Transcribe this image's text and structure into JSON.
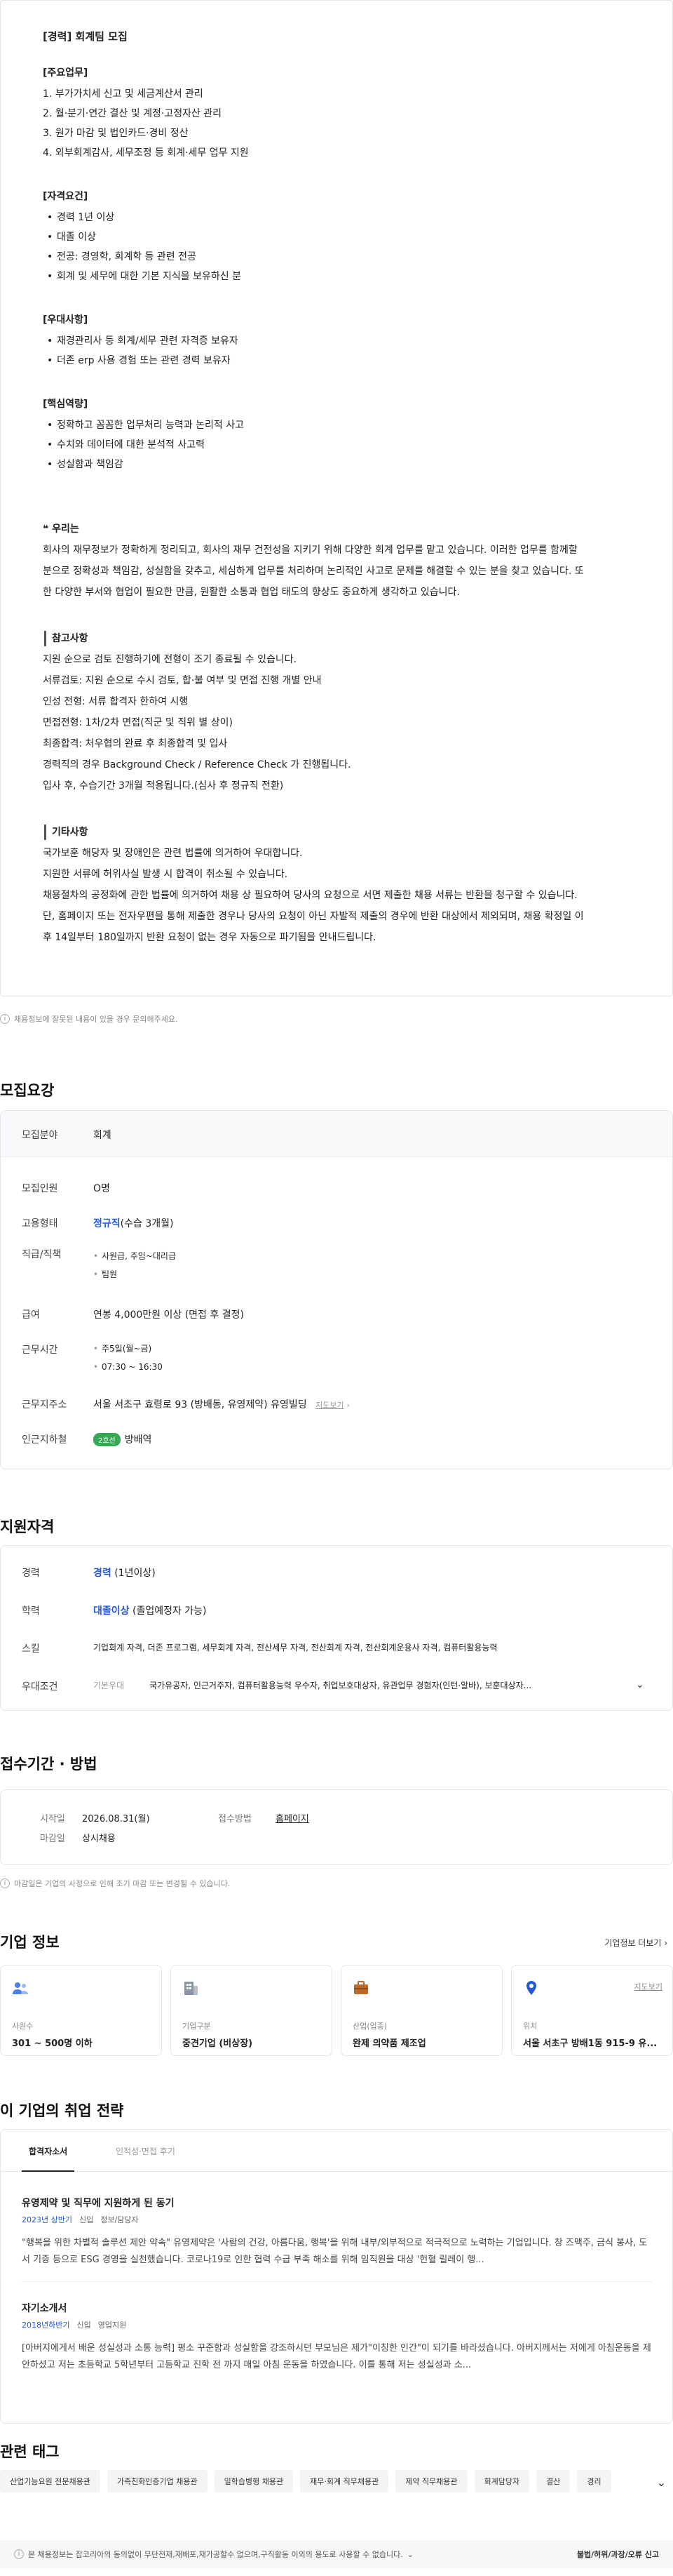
{
  "jd": {
    "title": "[경력] 회계팀 모집",
    "duty_title": "[주요업무]",
    "duties": [
      "1. 부가가치세 신고 및 세금계산서 관리",
      "2. 월·분기·연간 결산 및 계정·고정자산 관리",
      "3. 원가 마감 및 법인카드·경비 정산",
      "4. 외부회계감사, 세무조정 등 회계·세무 업무 지원"
    ],
    "qual_title": "[자격요건]",
    "quals": [
      "경력 1년 이상",
      "대졸 이상",
      "전공: 경영학, 회계학 등 관련 전공",
      "회계 및 세무에 대한 기본 지식을 보유하신 분"
    ],
    "pref_title": "[우대사항]",
    "prefs": [
      "재경관리사 등 회계/세무 관련 자격증 보유자",
      "더존 erp 사용 경험 또는 관련 경력 보유자"
    ],
    "core_title": "[핵심역량]",
    "cores": [
      "정확하고 꼼꼼한 업무처리 능력과 논리적 사고",
      "수치와 데이터에 대한 분석적 사고력",
      "성실함과 책임감"
    ],
    "we_title": "❝ 우리는",
    "we_text": "회사의 재무정보가 정확하게 정리되고, 회사의 재무 건전성을 지키기 위해 다양한 회계 업무를 맡고 있습니다. 이러한 업무를 함께할 분으로 정확성과 책임감, 성실함을 갖추고, 세심하게 업무를 처리하며 논리적인 사고로 문제를 해결할 수 있는 분을 찾고 있습니다. 또한 다양한 부서와 협업이 필요한 만큼, 원활한 소통과 협업 태도의 향상도 중요하게 생각하고 있습니다.",
    "ref_title": "참고사항",
    "refs": [
      "지원 순으로 검토 진행하기에 전형이 조기 종료될 수 있습니다.",
      "서류검토: 지원 순으로 수시 검토, 합·불 여부 및 면접 진행 개별 안내",
      "인성 전형: 서류 합격자 한하여 시행",
      "면접전형: 1차/2차 면접(직군 및 직위 별 상이)",
      "최종합격: 처우협의 완료 후 최종합격 및 입사",
      "경력직의 경우 Background Check / Reference Check 가 진행됩니다.",
      "입사 후, 수습기간 3개월 적용됩니다.(심사 후 정규직 전환)"
    ],
    "etc_title": "기타사항",
    "etc": [
      "국가보훈 해당자 및 장애인은 관련 법률에 의거하여 우대합니다.",
      "지원한 서류에 허위사실 발생 시 합격이 취소될 수 있습니다.",
      "채용절차의 공정화에 관한 법률에 의거하여 채용 상 필요하여 당사의 요청으로 서면 제출한 채용 서류는 반환을 청구할 수 있습니다. 단, 홈페이지 또는 전자우편을 통해 제출한 경우나 당사의 요청이 아닌 자발적 제출의 경우에 반환 대상에서 제외되며, 채용 확정일 이후 14일부터 180일까지 반환 요청이 없는 경우 자동으로 파기됨을 안내드립니다."
    ]
  },
  "notice": "채용정보에 잘못된 내용이 있을 경우 문의해주세요.",
  "recruit": {
    "heading": "모집요강",
    "field_k": "모집분야",
    "field_v": "회계",
    "count_k": "모집인원",
    "count_v": "O명",
    "type_k": "고용형태",
    "type_v": "정규직",
    "type_note": "(수습 3개월)",
    "rank_k": "직급/직책",
    "ranks": [
      "사원급, 주임~대리급",
      "팀원"
    ],
    "pay_k": "급여",
    "pay_v": "연봉 4,000만원 이상 (면접 후 결정)",
    "time_k": "근무시간",
    "times": [
      "주5일(월~금)",
      "07:30 ~ 16:30"
    ],
    "addr_k": "근무지주소",
    "addr_v": "서울 서초구 효령로 93 (방배동, 유영제약) 유영빌딩",
    "map_link": "지도보기",
    "subway_k": "인근지하철",
    "subway_line": "2호선",
    "subway_v": "방배역"
  },
  "qual": {
    "heading": "지원자격",
    "career_k": "경력",
    "career_v": "경력",
    "career_note": "(1년이상)",
    "edu_k": "학력",
    "edu_v": "대졸이상",
    "edu_note": "(졸업예정자 가능)",
    "skill_k": "스킬",
    "skill_v": "기업회계 자격, 더존 프로그램, 세무회계 자격, 전산세무 자격, 전산회계 자격, 전산회계운용사 자격, 컴퓨터활용능력",
    "pref_k": "우대조건",
    "pref_label": "기본우대",
    "pref_v": "국가유공자, 인근거주자, 컴퓨터활용능력 우수자, 취업보호대상자, 유관업무 경험자(인턴·알바), 보훈대상자..."
  },
  "period": {
    "heading": "접수기간 · 방법",
    "start_k": "시작일",
    "start_v": "2026.08.31(월)",
    "end_k": "마감일",
    "end_v": "상시채용",
    "method_k": "접수방법",
    "method_v": "홈페이지",
    "note": "마감일은 기업의 사정으로 인해 조기 마감 또는 변경될 수 있습니다."
  },
  "company": {
    "heading": "기업 정보",
    "more": "기업정보 더보기 ›",
    "cards": [
      {
        "label": "사원수",
        "value": "301 ~ 500명 이하",
        "icon": "people-icon"
      },
      {
        "label": "기업구분",
        "value": "중견기업 (비상장)",
        "icon": "building-icon"
      },
      {
        "label": "산업(업종)",
        "value": "완제 의약품 제조업",
        "icon": "briefcase-icon"
      },
      {
        "label": "위치",
        "value": "서울 서초구 방배1동 915-9 유...",
        "icon": "location-icon",
        "link": "지도보기"
      }
    ]
  },
  "strategy": {
    "heading": "이 기업의 취업 전략",
    "tab1": "합격자소서",
    "tab2": "인적성·면접 후기",
    "q1": "유영제약 및 직무에 지원하게 된 동기",
    "q1_meta": [
      "2023년 상반기",
      "신입",
      "정보/담당자"
    ],
    "q1_ans": "\"행복을 위한 차별적 솔루션 제안 약속\" 유영제약은 '사람의 건강, 아름다움, 행복'을 위해 내부/외부적으로 적극적으로 노력하는 기업입니다. 창 즈맥주, 금식 봉사, 도서 기증 등으로 ESG 경영을 실천했습니다. 코로나19로 인한 협력 수급 부족 해소를 위해 임직원을 대상 '헌혈 릴레이 행...",
    "q2": "자기소개서",
    "q2_meta": [
      "2018년하반기",
      "신입",
      "영업지원"
    ],
    "q2_ans": "[아버지에게서 배운 성실성과 소통 능력] 평소 꾸준함과 성실함을 강조하시던 부모님은 제가\"이칭한 인간\"이 되기를 바라셨습니다. 아버지께서는 저에게 아침운동을 제안하셨고 저는 초등학교 5학년부터 고등학교 진학 전 까지 매일 아침 운동을 하였습니다. 이를 통해 저는 성실성과 소..."
  },
  "tags": {
    "heading": "관련 태그",
    "items": [
      "산업기능요원 전문채용관",
      "가족친화인증기업 채용관",
      "일학습병행 채용관",
      "재무·회계 직무채용관",
      "제약 직무채용관",
      "회계담당자",
      "결산",
      "경리"
    ]
  },
  "footer": {
    "left": "본 채용정보는 잡코리아의 동의없이 무단전재,재배포,재가공할수 없으며,구직활동 이외의 용도로 사용할 수 없습니다.",
    "right": "불법/허위/과장/오류 신고"
  }
}
